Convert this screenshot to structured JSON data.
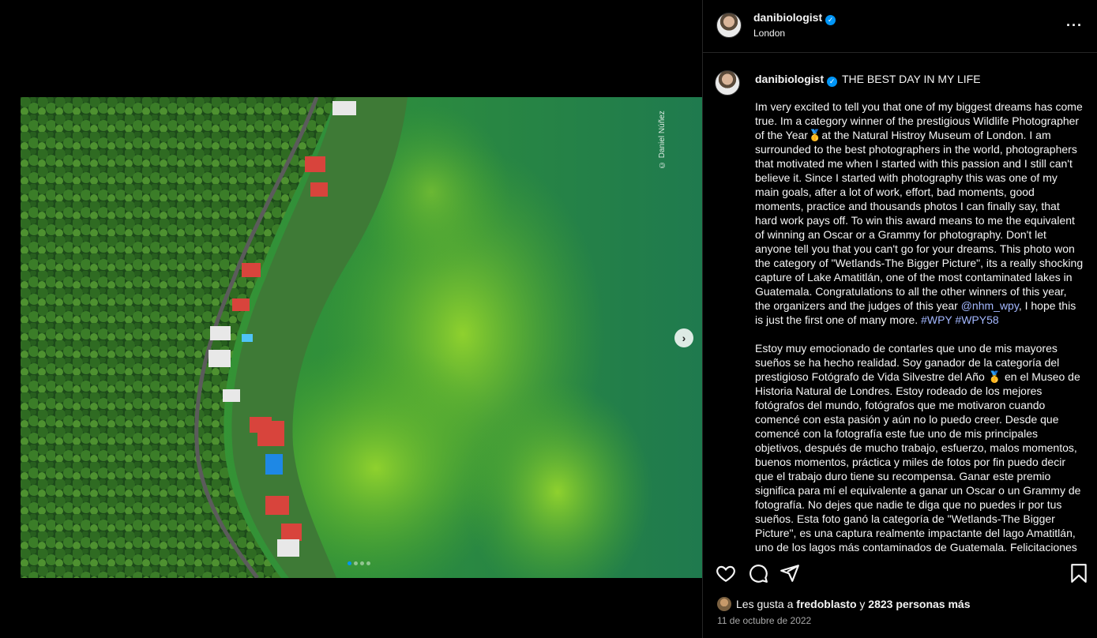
{
  "post": {
    "username": "danibiologist",
    "location": "London",
    "headline": "THE BEST DAY IN MY LIFE",
    "caption_en": "Im very excited to tell you that one of my biggest dreams has come true. Im a category winner of the prestigious Wildlife Photographer of the Year🥇at the Natural Histroy Museum of London. I am surrounded to the best photographers in the world, photographers that motivated me when I started with this passion and I still can't believe it. Since I started with photography this was one of my main goals, after a lot of work, effort, bad moments, good moments, practice and thousands photos I can finally say, that hard work pays off. To win this award means to me the equivalent of winning an Oscar or a Grammy for photography. Don't let anyone tell you that you can't go for your dreams. This photo won the category of \"Wetlands-The Bigger Picture\", its a really shocking capture of Lake Amatitlán, one of the most contaminated lakes in Guatemala. Congratulations to all the other winners of this year, the organizers and the judges of this year",
    "mention": "@nhm_wpy",
    "caption_en_end": ", I hope this is just the first one of many more.",
    "hashtags": "#WPY #WPY58",
    "caption_es": "Estoy muy emocionado de contarles que uno de mis mayores sueños se ha hecho realidad. Soy ganador de la categoría del prestigioso Fotógrafo de Vida Silvestre del Año 🥇 en el Museo de Historia Natural de Londres. Estoy rodeado de los mejores fotógrafos del mundo, fotógrafos que me motivaron cuando comencé con esta pasión y aún no lo puedo creer. Desde que comencé con la fotografía este fue uno de mis principales objetivos, después de mucho trabajo, esfuerzo, malos momentos, buenos momentos, práctica y miles de fotos por fin puedo decir que el trabajo duro tiene su recompensa. Ganar este premio significa para mí el equivalente a ganar un Oscar o un Grammy de fotografía. No dejes que nadie te diga que no puedes ir por tus sueños. Esta foto ganó la categoría de \"Wetlands-The Bigger Picture\", es una captura realmente impactante del lago Amatitlán, uno de los lagos más contaminados de Guatemala. Felicitaciones a",
    "photo_credit": "© Daniel Núñez",
    "likes_prefix": "Les gusta a",
    "liker": "fredoblasto",
    "likes_connector": "y",
    "likes_count": "2823 personas más",
    "date": "11 de octubre de 2022"
  },
  "icons": {
    "more": "more-options-icon",
    "next": "chevron-right-icon",
    "like": "heart-icon",
    "comment": "comment-icon",
    "share": "share-icon",
    "save": "bookmark-icon"
  },
  "carousel": {
    "slide_count": 4,
    "active_index": 0
  },
  "colors": {
    "background": "#000000",
    "verified": "#0095f6",
    "link": "#a4b8ff",
    "muted": "#a8a8a8"
  }
}
